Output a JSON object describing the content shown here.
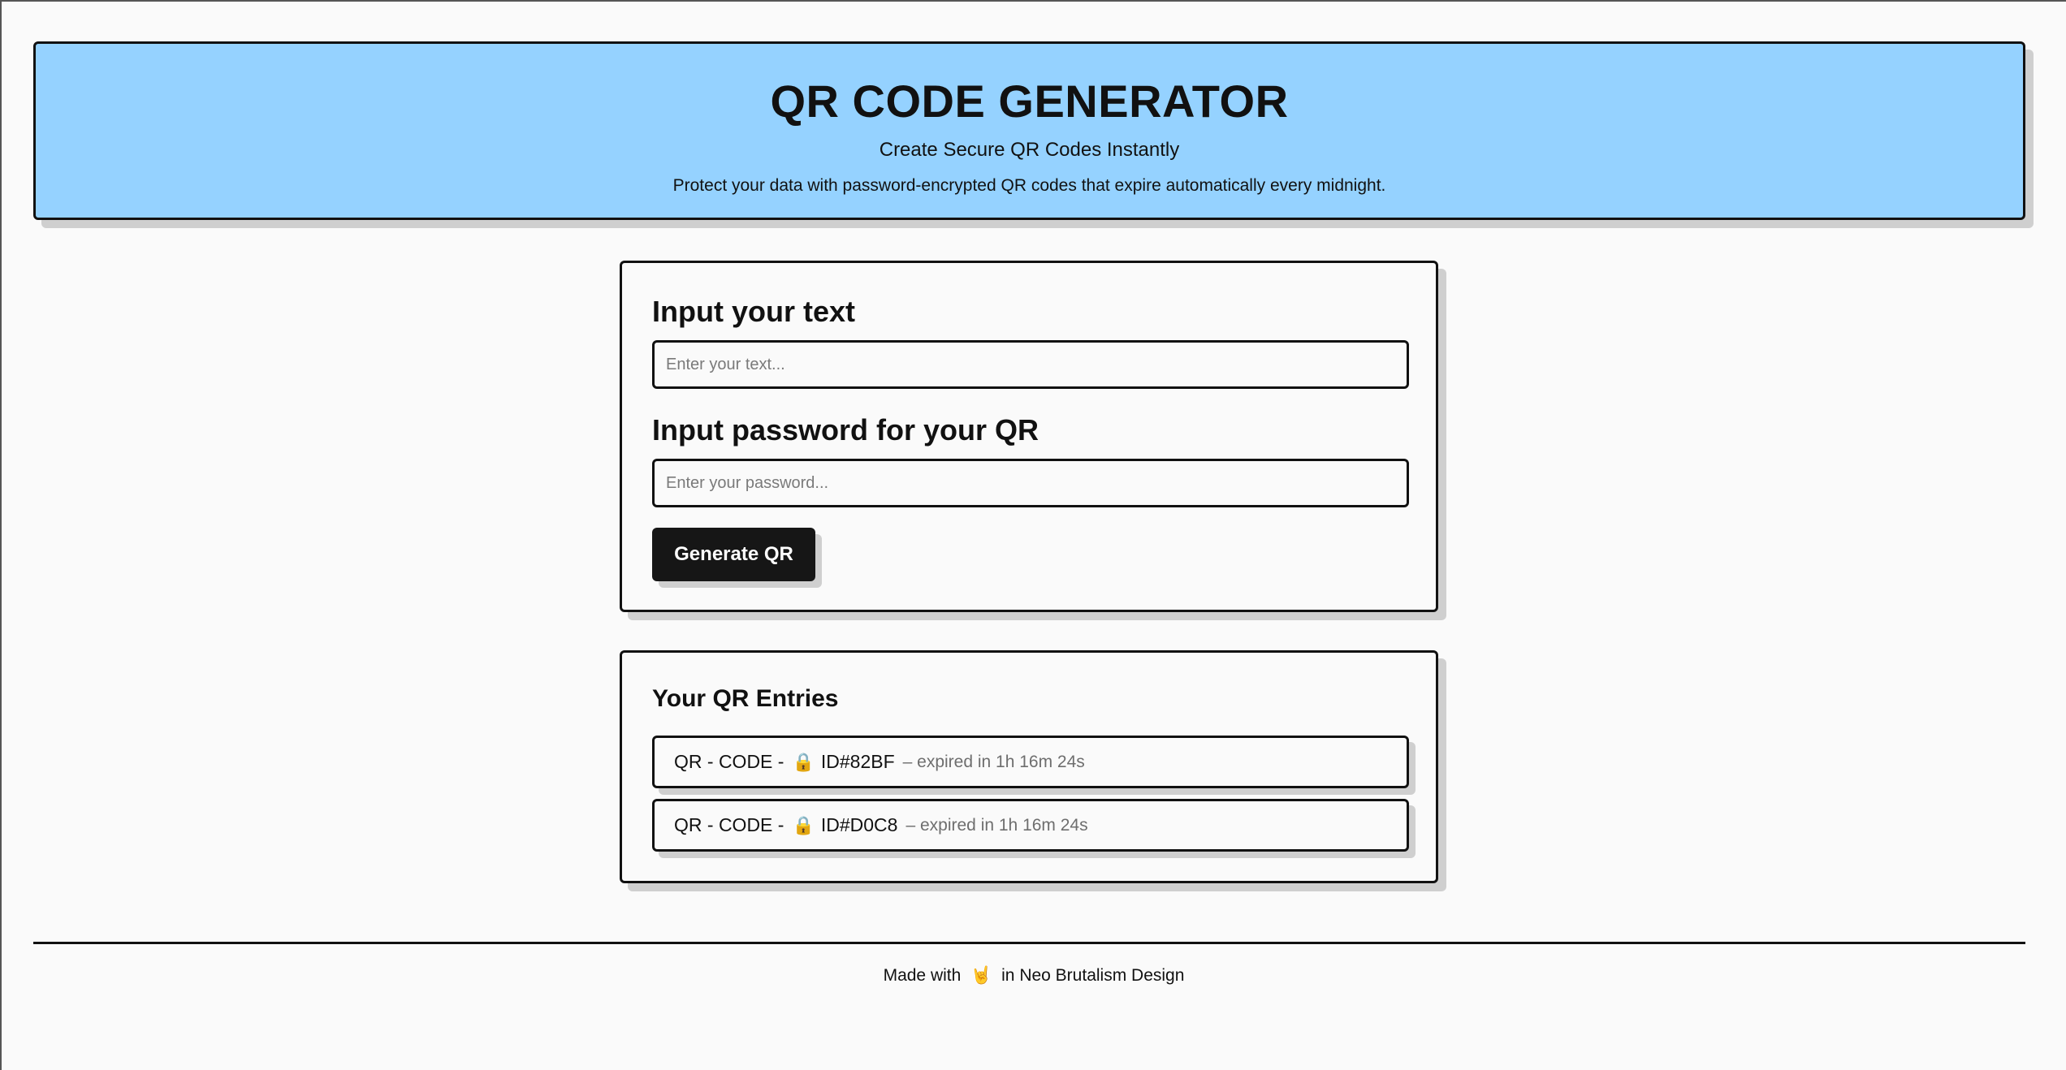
{
  "header": {
    "title": "QR CODE GENERATOR",
    "subtitle": "Create Secure QR Codes Instantly",
    "description": "Protect your data with password-encrypted QR codes that expire automatically every midnight.",
    "background_color": "#95d2ff"
  },
  "form": {
    "text_heading": "Input your text",
    "text_placeholder": "Enter your text...",
    "text_value": "",
    "password_heading": "Input password for your QR",
    "password_placeholder": "Enter your password...",
    "password_value": "",
    "generate_label": "Generate QR"
  },
  "entries": {
    "heading": "Your QR Entries",
    "items": [
      {
        "prefix": "QR - CODE -",
        "icon": "lock-icon",
        "lock_glyph": "🔒",
        "id": "ID#82BF",
        "expiry": "– expired in 1h 16m 24s"
      },
      {
        "prefix": "QR - CODE -",
        "icon": "lock-icon",
        "lock_glyph": "🔒",
        "id": "ID#D0C8",
        "expiry": "– expired in 1h 16m 24s"
      }
    ]
  },
  "footer": {
    "before": "Made with",
    "emoji": "🤘",
    "after": "in Neo Brutalism Design"
  }
}
